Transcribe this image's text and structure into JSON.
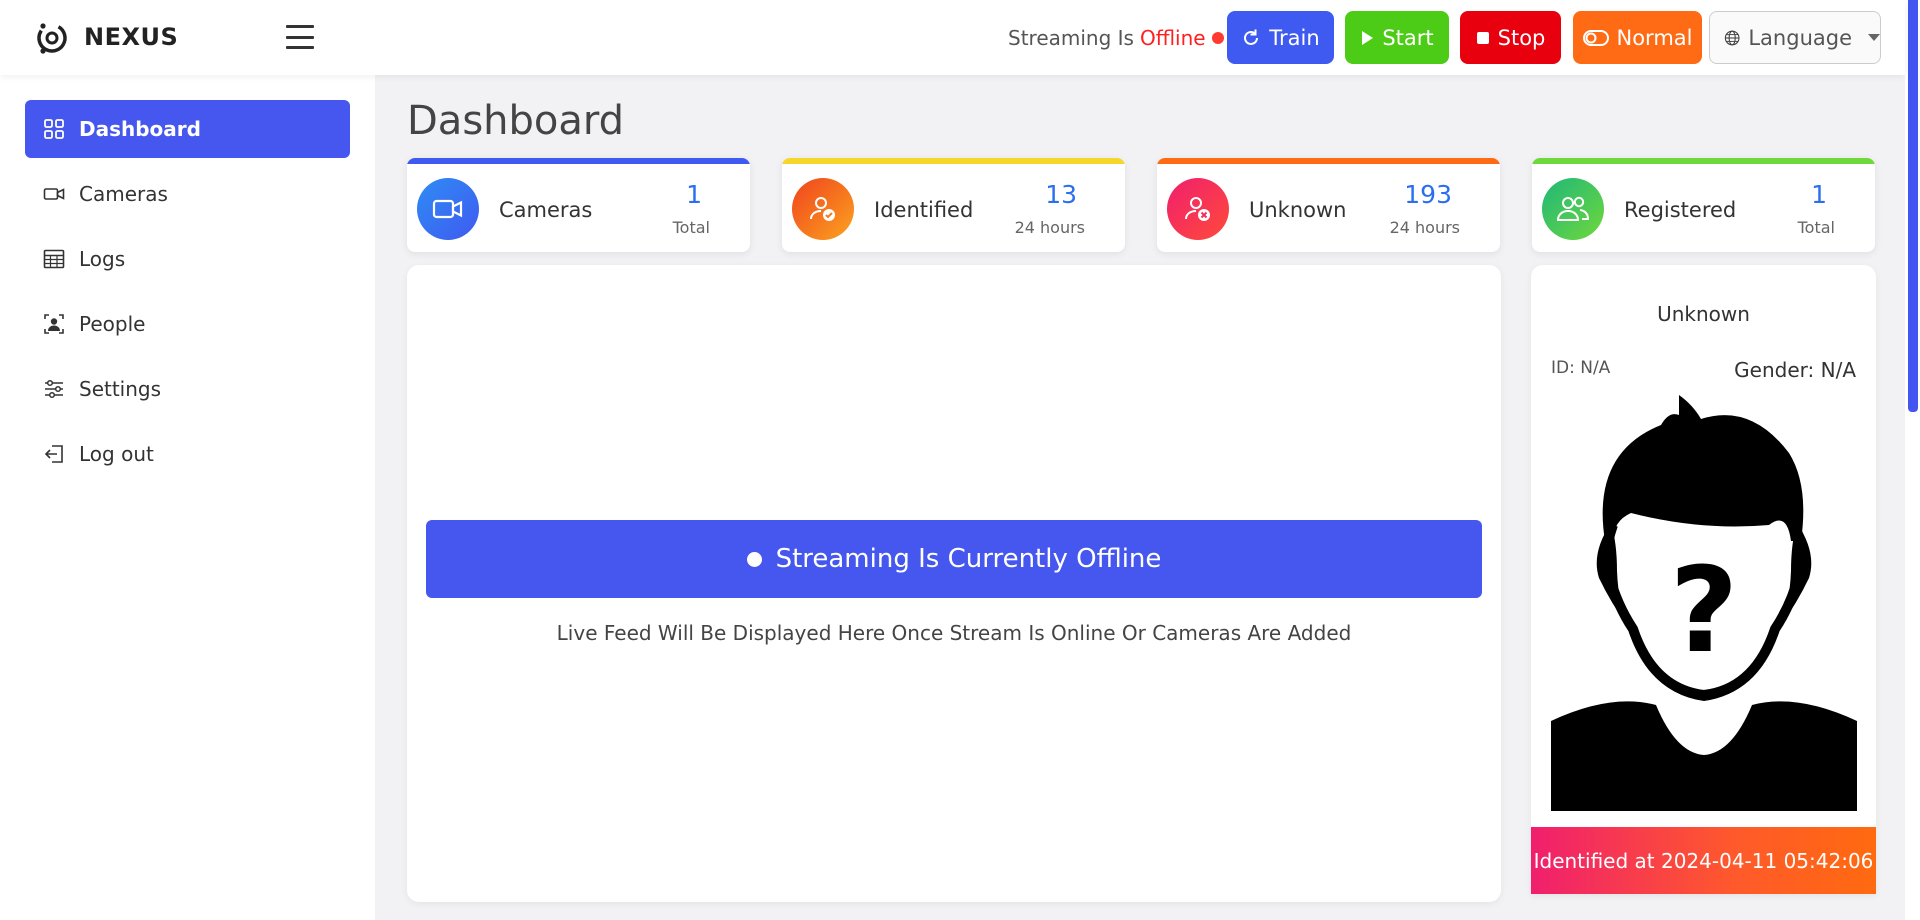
{
  "brand": {
    "name": "NEXUS"
  },
  "header": {
    "stream_status_prefix": "Streaming Is",
    "stream_status_value": "Offline",
    "buttons": {
      "train": "Train",
      "start": "Start",
      "stop": "Stop",
      "normal": "Normal",
      "language": "Language"
    }
  },
  "sidebar": {
    "items": [
      {
        "label": "Dashboard",
        "icon": "grid-icon",
        "active": true
      },
      {
        "label": "Cameras",
        "icon": "video-camera-icon"
      },
      {
        "label": "Logs",
        "icon": "table-icon"
      },
      {
        "label": "People",
        "icon": "user-badge-icon"
      },
      {
        "label": "Settings",
        "icon": "sliders-icon"
      },
      {
        "label": "Log out",
        "icon": "logout-icon"
      }
    ]
  },
  "main": {
    "title": "Dashboard",
    "stats": [
      {
        "label": "Cameras",
        "value": "1",
        "sub": "Total",
        "color": "#3f5af0",
        "icon": "video-camera-icon"
      },
      {
        "label": "Identified",
        "value": "13",
        "sub": "24 hours",
        "color": "#f5d62a",
        "icon": "user-check-icon"
      },
      {
        "label": "Unknown",
        "value": "193",
        "sub": "24 hours",
        "color": "#ff6a14",
        "icon": "user-x-icon"
      },
      {
        "label": "Registered",
        "value": "1",
        "sub": "Total",
        "color": "#6fd83a",
        "icon": "users-icon"
      }
    ],
    "feed": {
      "banner": "Streaming Is Currently Offline",
      "note": "Live Feed Will Be Displayed Here Once Stream Is Online Or Cameras Are Added"
    },
    "profile": {
      "name": "Unknown",
      "id": "ID: N/A",
      "gender": "Gender: N/A",
      "footer": "Identified at 2024-04-11 05:42:06"
    }
  },
  "colors": {
    "accent": "#4557ee",
    "offline": "#ff2020",
    "start": "#4dcc17",
    "stop": "#e8000f",
    "normal": "#ff6a14"
  }
}
